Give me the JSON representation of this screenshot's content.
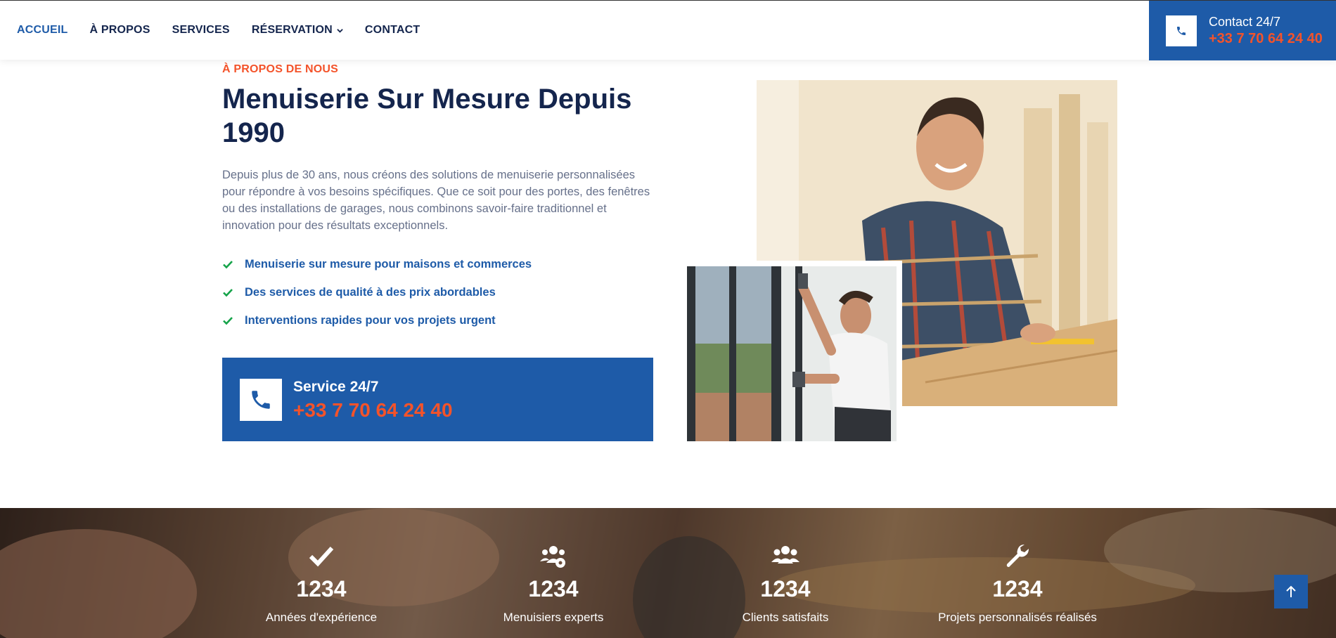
{
  "nav": {
    "items": [
      {
        "label": "ACCUEIL"
      },
      {
        "label": "À PROPOS"
      },
      {
        "label": "SERVICES"
      },
      {
        "label": "RÉSERVATION"
      },
      {
        "label": "CONTACT"
      }
    ],
    "contact_label": "Contact 24/7",
    "contact_number": "+33 7 70 64 24 40"
  },
  "about": {
    "kicker": "À PROPOS DE NOUS",
    "title": "Menuiserie Sur Mesure Depuis 1990",
    "description": "Depuis plus de 30 ans, nous créons des solutions de menuiserie personnalisées pour répondre à vos besoins spécifiques. Que ce soit pour des portes, des fenêtres ou des installations de garages, nous combinons savoir-faire traditionnel et innovation pour des résultats exceptionnels.",
    "features": [
      "Menuiserie sur mesure pour maisons et commerces",
      "Des services de qualité à des prix abordables",
      "Interventions rapides pour vos projets urgent"
    ],
    "service_label": "Service 24/7",
    "service_number": "+33 7 70 64 24 40"
  },
  "stats": [
    {
      "icon": "check-icon",
      "value": "1234",
      "label": "Années d'expérience"
    },
    {
      "icon": "users-gear-icon",
      "value": "1234",
      "label": "Menuisiers experts"
    },
    {
      "icon": "users-icon",
      "value": "1234",
      "label": "Clients satisfaits"
    },
    {
      "icon": "wrench-icon",
      "value": "1234",
      "label": "Projets personnalisés réalisés"
    }
  ],
  "colors": {
    "primary": "#1e5ba8",
    "accent": "#f4532a",
    "navy": "#14254d",
    "check": "#16a34a"
  }
}
